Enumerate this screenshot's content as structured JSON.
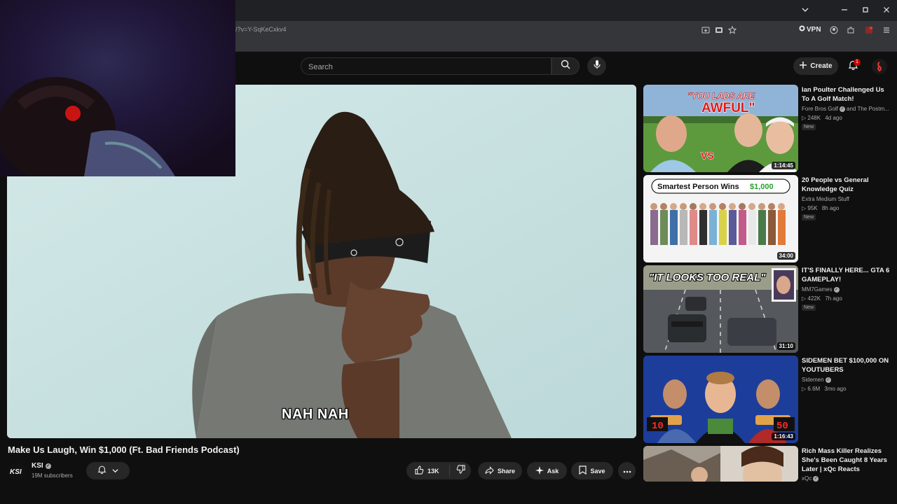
{
  "browser": {
    "url": "/?v=Y-SqKeCxkv4",
    "vpn_label": "VPN",
    "window_controls": [
      "chevron-down-icon",
      "minimize-icon",
      "restore-icon",
      "close-icon"
    ]
  },
  "header": {
    "search_placeholder": "Search",
    "create_label": "Create",
    "notification_count": "1"
  },
  "video": {
    "caption": "NAH NAH",
    "title": "Make Us Laugh, Win $1,000 (Ft. Bad Friends Podcast)",
    "channel": "KSI",
    "subscribers": "19M subscribers",
    "like_count": "13K",
    "share_label": "Share",
    "ask_label": "Ask",
    "save_label": "Save"
  },
  "recommendations": [
    {
      "title": "Ian Poulter Challenged Us To A Golf Match!",
      "channel": "Fore Bros Golf",
      "channel_extra": "and The Postm...",
      "views": "248K",
      "age": "4d ago",
      "badge": "New",
      "duration": "1:14:45",
      "thumb_text_1": "\"YOU LADS ARE",
      "thumb_text_2": "AWFUL\"",
      "thumb_text_3": "VS"
    },
    {
      "title": "20 People vs General Knowledge Quiz",
      "channel": "Extra Medium Stuff",
      "views": "95K",
      "age": "8h ago",
      "badge": "New",
      "duration": "34:00",
      "thumb_text_1": "Smartest Person Wins",
      "thumb_text_2": "$1,000"
    },
    {
      "title": "IT'S FINALLY HERE... GTA 6 GAMEPLAY!",
      "channel": "MM7Games",
      "views": "422K",
      "age": "7h ago",
      "badge": "New",
      "duration": "31:10",
      "thumb_text_1": "\"IT LOOKS TOO REAL\""
    },
    {
      "title": "SIDEMEN BET $100,000 ON YOUTUBERS",
      "channel": "Sidemen",
      "views": "6.6M",
      "age": "3mo ago",
      "duration": "1:16:43",
      "thumb_text_1": "10",
      "thumb_text_2": "50"
    },
    {
      "title": "Rich Mass Killer Realizes She's Been Caught 8 Years Later | xQc Reacts",
      "channel": "xQc"
    }
  ],
  "colors": {
    "background": "#0f0f0f",
    "pill": "#272727",
    "accent_red": "#cc0000",
    "player_bg": "#cfe6e6"
  }
}
